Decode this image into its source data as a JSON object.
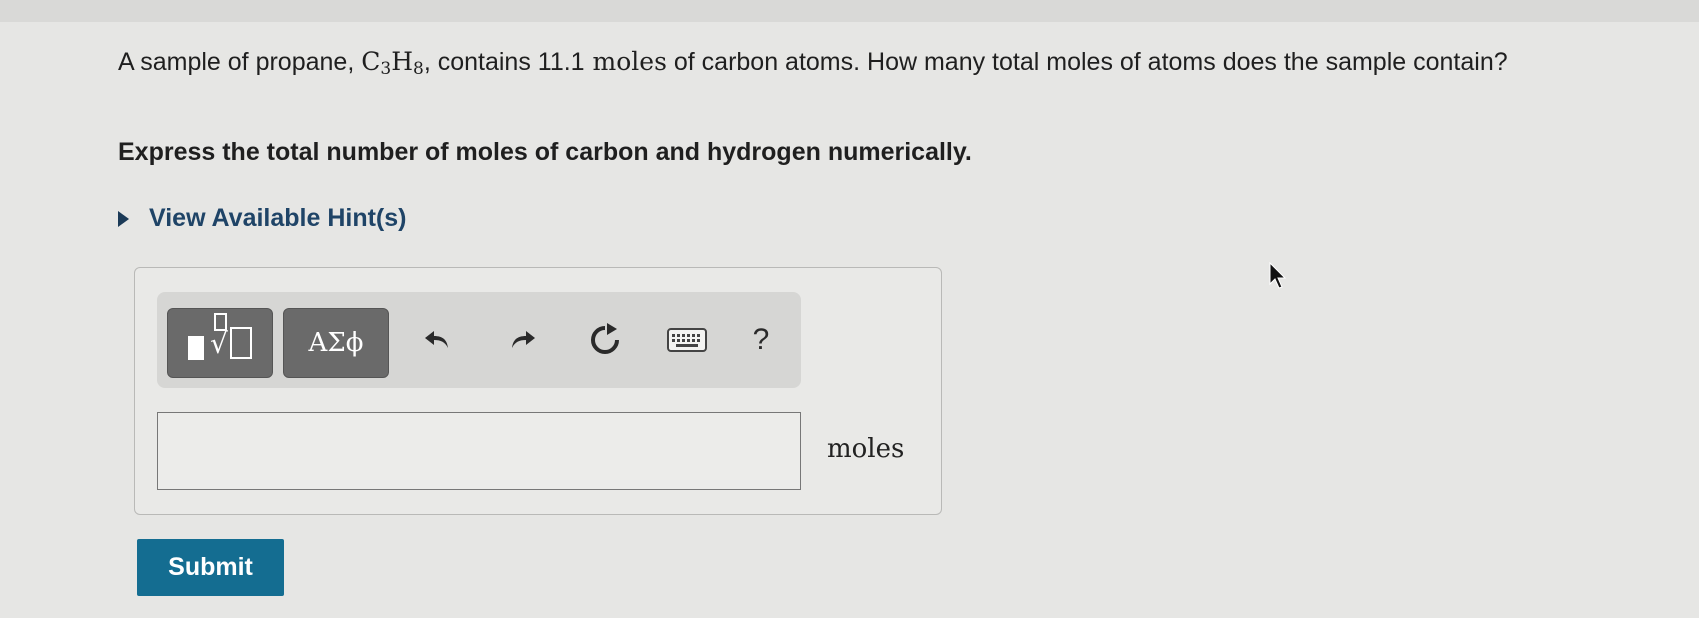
{
  "question": {
    "part1": "A sample of propane, ",
    "formula": {
      "c": "C",
      "c_sub": "3",
      "h": "H",
      "h_sub": "8"
    },
    "part2": ", contains ",
    "amount": "11.1",
    "part3": " moles",
    "part4": " of carbon atoms. How many total moles of atoms does the sample contain?"
  },
  "instruction": "Express the total number of moles of carbon and hydrogen numerically.",
  "hint": {
    "label": "View Available Hint(s)",
    "icon": "caret-right-icon"
  },
  "toolbar": {
    "template_icon": "templates-icon",
    "greek_label": "ΑΣϕ",
    "undo_icon": "undo-icon",
    "redo_icon": "redo-icon",
    "reset_icon": "reset-icon",
    "keyboard_icon": "keyboard-icon",
    "help_label": "?"
  },
  "answer": {
    "value": "",
    "unit": "moles"
  },
  "submit": {
    "label": "Submit",
    "color": "#146d91"
  },
  "colors": {
    "background": "#e6e6e4",
    "hint_text": "#1f4467",
    "toolbar_button": "#6a6a6a"
  }
}
